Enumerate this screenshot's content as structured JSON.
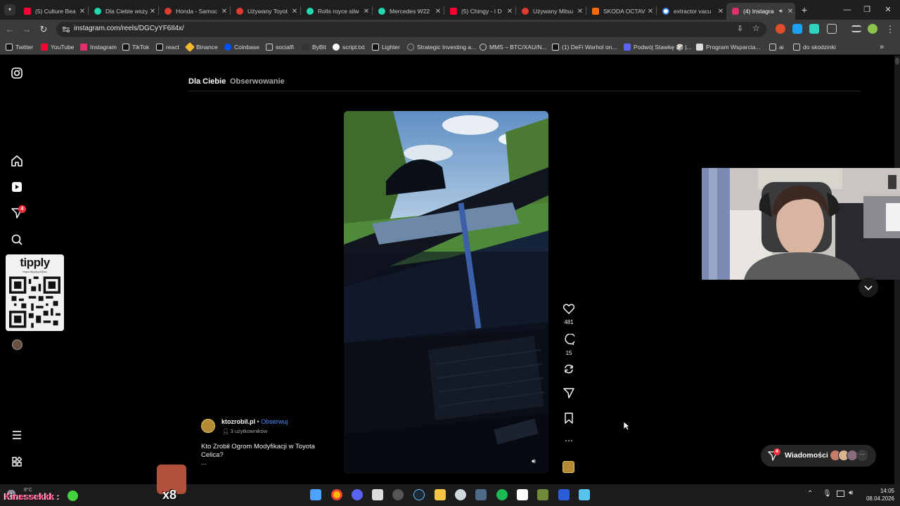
{
  "browser": {
    "tabs": [
      {
        "title": "(5) Culture Bea",
        "fav_color": "#ff0033"
      },
      {
        "title": "Dla Ciebie wszy",
        "fav_color": "#25d6b3"
      },
      {
        "title": "Honda - Samoc",
        "fav_color": "#e03b2f"
      },
      {
        "title": "Używany Toyot",
        "fav_color": "#e03b2f"
      },
      {
        "title": "Rolls royce silw",
        "fav_color": "#25d6b3"
      },
      {
        "title": "Mercedes W22",
        "fav_color": "#25d6b3"
      },
      {
        "title": "(5) Chingy - I D",
        "fav_color": "#ff0033"
      },
      {
        "title": "Używany Mitsu",
        "fav_color": "#e03b2f"
      },
      {
        "title": "SKODA OCTAV",
        "fav_color": "#ff6a00"
      },
      {
        "title": "extractor vacu",
        "fav_color": "#ffffff"
      },
      {
        "title": "(4) Instagra",
        "fav_color": "#e1306c"
      }
    ],
    "url": "instagram.com/reels/DGCyYF6Il4x/",
    "bookmarks": [
      {
        "label": "Twitter",
        "color": "#ffffff"
      },
      {
        "label": "YouTube",
        "color": "#ff0033"
      },
      {
        "label": "Instagram",
        "color": "#e1306c"
      },
      {
        "label": "TikTok",
        "color": "#ffffff"
      },
      {
        "label": "react",
        "color": "#ffffff"
      },
      {
        "label": "Binance",
        "color": "#f3ba2f"
      },
      {
        "label": "Coinbase",
        "color": "#0052ff"
      },
      {
        "label": "socialfi",
        "color": "#cccccc"
      },
      {
        "label": "ByBit",
        "color": "#cccccc"
      },
      {
        "label": "script.txt",
        "color": "#ffffff"
      },
      {
        "label": "Lighter",
        "color": "#ffffff"
      },
      {
        "label": "Strategic Investing a...",
        "color": "#cccccc"
      },
      {
        "label": "MMS – BTC/XAU/N...",
        "color": "#cccccc"
      },
      {
        "label": "(1) DeFi Warhol on...",
        "color": "#ffffff"
      },
      {
        "label": "Podwój Stawkę 🎲 |...",
        "color": "#5865f2"
      },
      {
        "label": "Program Wsparcia...",
        "color": "#ffffff"
      },
      {
        "label": "ai",
        "color": "#cccccc"
      },
      {
        "label": "do skodzinki",
        "color": "#cccccc"
      }
    ]
  },
  "instagram": {
    "nav_tabs": {
      "for_you": "Dla Ciebie",
      "following": "Obserwowanie"
    },
    "sidebar_badge": "4",
    "tipply": {
      "brand": "tipply",
      "url": "https://tipply.pl/@ss"
    },
    "reel": {
      "author": "ktozrobil.pl",
      "dot": "•",
      "follow": "Obserwuj",
      "audience": "3 użytkowników",
      "caption": "Kto Zrobił Ogrom Modyfikacji w Toyota Celica?",
      "more": "...",
      "likes": "481",
      "comments": "15"
    },
    "messages": {
      "label": "Wiadomości",
      "badge": "4"
    },
    "accent": "#4c8dff"
  },
  "stream_overlay": {
    "user": "Kinessekkk :",
    "multiplier": "x8",
    "temp": "8°C"
  },
  "taskbar": {
    "time": "14:05",
    "date": "08.04.2026"
  }
}
